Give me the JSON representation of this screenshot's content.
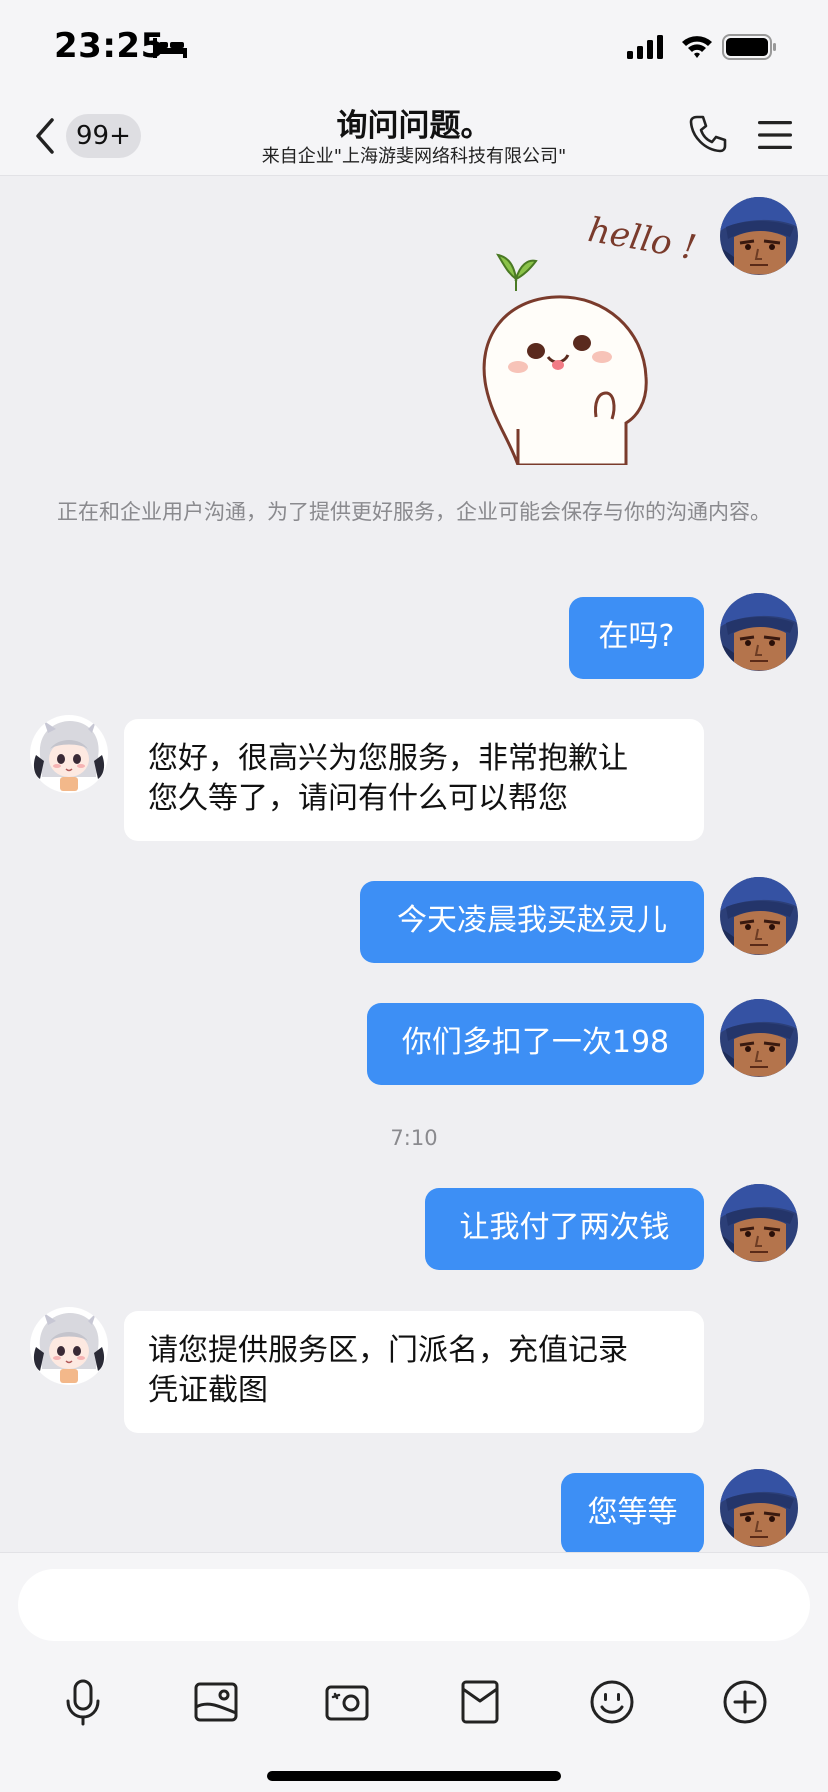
{
  "status_bar": {
    "time": "23:25"
  },
  "header": {
    "badge": "99+",
    "title": "询问问题。",
    "subtitle": "来自企业\"上海游斐网络科技有限公司\""
  },
  "chat": {
    "notice": "正在和企业用户沟通，为了提供更好服务，企业可能会保存与你的沟通内容。",
    "sticker_text": "hello !",
    "messages": [
      {
        "side": "out",
        "text": "在吗?"
      },
      {
        "side": "in",
        "text": "您好，很高兴为您服务，非常抱歉让\n您久等了，请问有什么可以帮您"
      },
      {
        "side": "out",
        "text": "今天凌晨我买赵灵儿"
      },
      {
        "side": "out",
        "text": "你们多扣了一次198"
      },
      {
        "side": "out",
        "text": "让我付了两次钱"
      },
      {
        "side": "in",
        "text": "请您提供服务区，门派名，充值记录\n凭证截图"
      },
      {
        "side": "out",
        "text": "您等等"
      }
    ],
    "timestamp": "7:10"
  },
  "composer": {
    "placeholder": ""
  },
  "icons": {
    "toolbar": [
      "microphone-icon",
      "image-icon",
      "camera-icon",
      "red-packet-icon",
      "emoji-icon",
      "plus-icon"
    ]
  },
  "colors": {
    "out_bubble": "#3d8ff5",
    "in_bubble": "#ffffff",
    "background": "#efeff2"
  }
}
